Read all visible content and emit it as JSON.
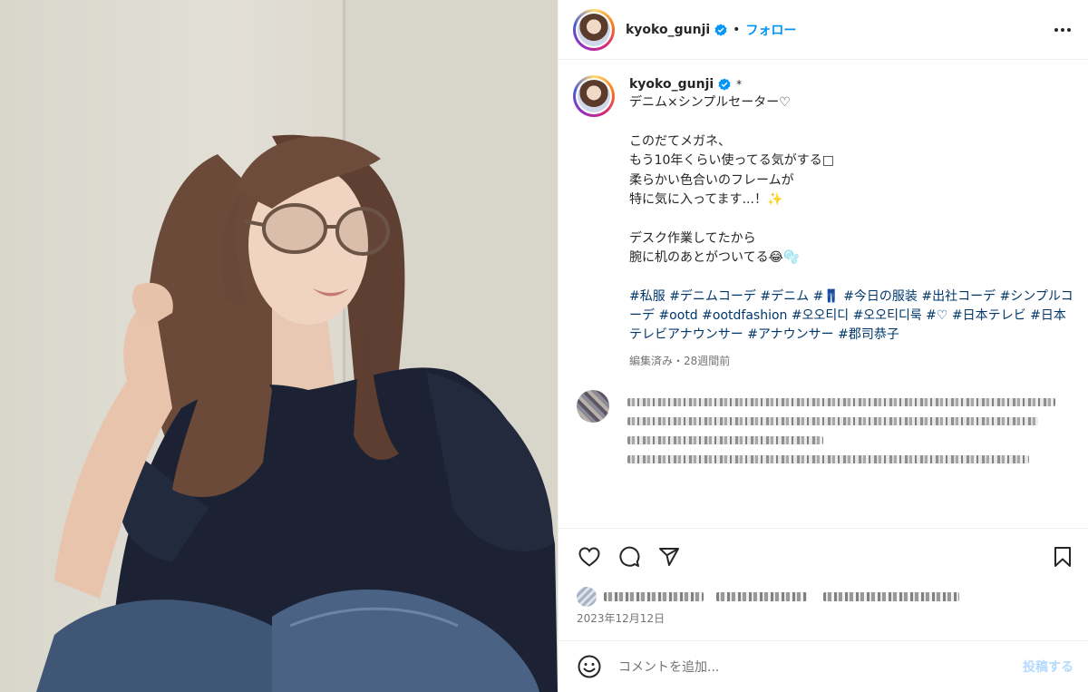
{
  "photo": {
    "alt": "woman-in-glasses-navy-sweater-denim"
  },
  "header": {
    "username": "kyoko_gunji",
    "separator": "•",
    "follow_label": "フォロー",
    "verified_icon": "verified-badge-icon",
    "more_icon": "more-horizontal-icon"
  },
  "caption": {
    "username": "kyoko_gunji",
    "star": "*",
    "text": "デニム×シンプルセーター♡\n\nこのだてメガネ、\nもう10年くらい使ってる気がする□\n柔らかい色合いのフレームが\n特に気に入ってます...！✨\n\nデスク作業してたから\n腕に机のあとがついてる😂🫧",
    "hashtags": [
      "#私服",
      "#デニムコーデ",
      "#デニム",
      "#👖",
      "#今日の服装",
      "#出社コーデ",
      "#シンプルコーデ",
      "#ootd",
      "#ootdfashion",
      "#오오티디",
      "#오오티디룩",
      "#♡",
      "#日本テレビ",
      "#日本テレビアナウンサー",
      "#アナウンサー",
      "#郡司恭子"
    ],
    "meta": "編集済み・28週間前"
  },
  "actions": {
    "like_icon": "heart-icon",
    "comment_icon": "comment-icon",
    "share_icon": "share-icon",
    "save_icon": "bookmark-icon"
  },
  "post": {
    "date": "2023年12月12日"
  },
  "add_comment": {
    "placeholder": "コメントを追加...",
    "post_label": "投稿する",
    "emoji_icon": "smile-icon"
  },
  "colors": {
    "link_blue": "#0095f6",
    "hashtag": "#00376b",
    "muted": "#737373",
    "post_disabled": "#b3dbff"
  }
}
